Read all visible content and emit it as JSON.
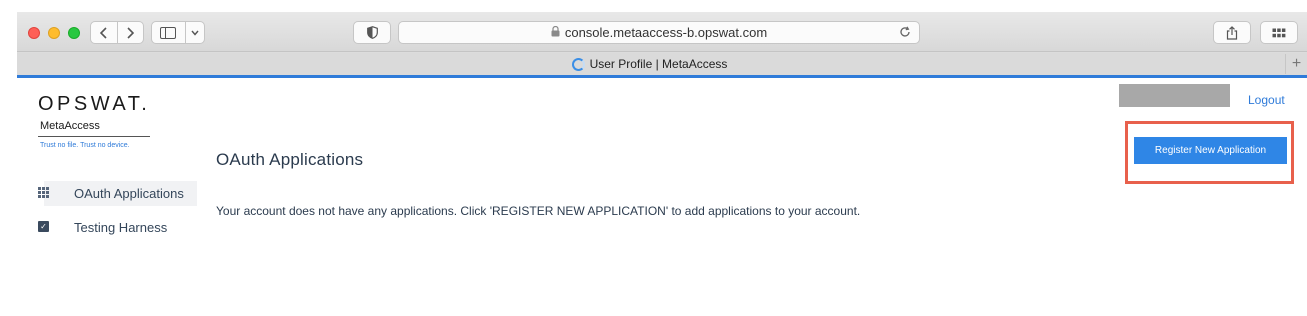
{
  "browser": {
    "url": "console.metaaccess-b.opswat.com",
    "tab_title": "User Profile | MetaAccess",
    "new_tab_symbol": "+",
    "icons": {
      "back": "chevron-left-icon",
      "forward": "chevron-right-icon",
      "sidebar": "sidebar-icon",
      "shield": "shield-icon",
      "lock": "lock-icon",
      "reload": "reload-icon",
      "share": "share-icon",
      "tabs": "tab-overview-icon"
    },
    "accent_color": "#2f7bd9"
  },
  "logo": {
    "brand": "OPSWAT.",
    "product": "MetaAccess",
    "tagline": "Trust no file. Trust no device."
  },
  "sidebar": {
    "items": [
      {
        "label": "OAuth Applications",
        "icon": "grid-icon",
        "active": true
      },
      {
        "label": "Testing Harness",
        "icon": "checklist-icon",
        "active": false
      }
    ]
  },
  "header": {
    "logout_label": "Logout"
  },
  "main": {
    "title": "OAuth Applications",
    "empty_message": "Your account does not have any applications. Click 'REGISTER NEW APPLICATION' to add applications to your account.",
    "register_button_label": "Register New Application"
  },
  "colors": {
    "primary_button": "#2f86e6",
    "highlight_border": "#e8604c",
    "link": "#2f7bd9",
    "text": "#2b3b4e"
  }
}
